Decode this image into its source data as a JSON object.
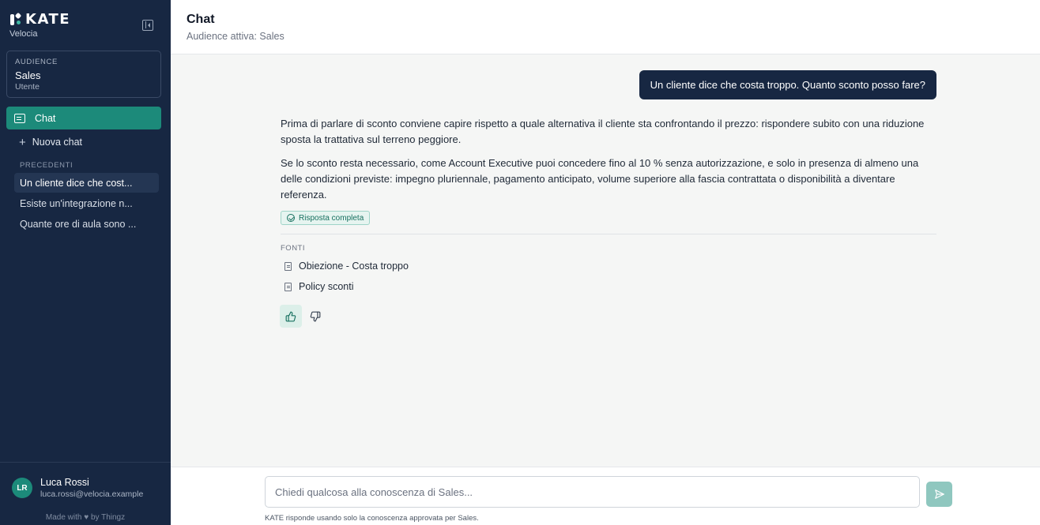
{
  "app": {
    "logo_text": "KATE",
    "org_name": "Velocia"
  },
  "audience": {
    "label": "AUDIENCE",
    "name": "Sales",
    "role": "Utente"
  },
  "nav": {
    "chat_label": "Chat",
    "new_chat_label": "Nuova chat"
  },
  "history": {
    "section_title": "PRECEDENTI",
    "items": [
      {
        "label": "Un cliente dice che cost...",
        "active": true
      },
      {
        "label": "Esiste un'integrazione n...",
        "active": false
      },
      {
        "label": "Quante ore di aula sono ...",
        "active": false
      }
    ]
  },
  "user": {
    "initials": "LR",
    "name": "Luca Rossi",
    "email": "luca.rossi@velocia.example"
  },
  "footer": {
    "made_with": "Made with",
    "by": "by Thingz"
  },
  "header": {
    "title": "Chat",
    "subtitle": "Audience attiva: Sales"
  },
  "conversation": {
    "user_message": "Un cliente dice che costa troppo. Quanto sconto posso fare?",
    "answer_paragraphs": [
      "Prima di parlare di sconto conviene capire rispetto a quale alternativa il cliente sta confrontando il prezzo: rispondere subito con una riduzione sposta la trattativa sul terreno peggiore.",
      "Se lo sconto resta necessario, come Account Executive puoi concedere fino al 10 % senza autorizzazione, e solo in presenza di almeno una delle condizioni previste: impegno pluriennale, pagamento anticipato, volume superiore alla fascia contrattata o disponibilità a diventare referenza."
    ],
    "status_badge": "Risposta completa",
    "sources_title": "FONTI",
    "sources": [
      "Obiezione - Costa troppo",
      "Policy sconti"
    ]
  },
  "composer": {
    "placeholder": "Chiedi qualcosa alla conoscenza di Sales...",
    "value": "",
    "disclaimer": "KATE risponde usando solo la conoscenza approvata per Sales."
  },
  "colors": {
    "sidebar_bg": "#172742",
    "accent": "#1c8a7a",
    "send_disabled": "#8fc7bf"
  }
}
